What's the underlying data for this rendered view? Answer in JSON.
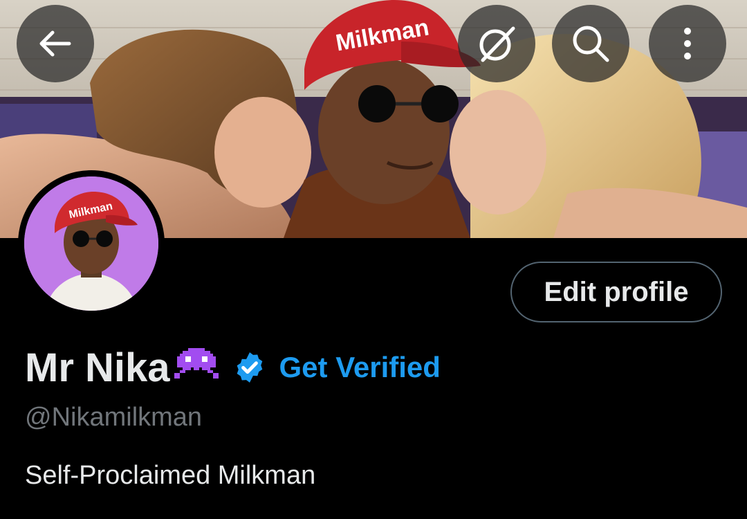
{
  "header": {
    "back_icon": "arrow-left-icon",
    "grok_icon": "grok-icon",
    "search_icon": "search-icon",
    "more_icon": "more-vertical-icon",
    "banner_cap_text": "Milkman"
  },
  "profile": {
    "avatar_cap_text": "Milkman",
    "edit_label": "Edit profile",
    "display_name": "Mr Nika",
    "name_emoji_icon": "alien-monster-icon",
    "verified_icon": "verified-badge-icon",
    "get_verified_label": "Get Verified",
    "handle": "@Nikamilkman",
    "bio": "Self-Proclaimed Milkman"
  },
  "colors": {
    "background": "#000000",
    "accent": "#1d9bf0",
    "text_primary": "#e7e9ea",
    "text_secondary": "#71767b",
    "avatar_bg": "#c07be8"
  }
}
